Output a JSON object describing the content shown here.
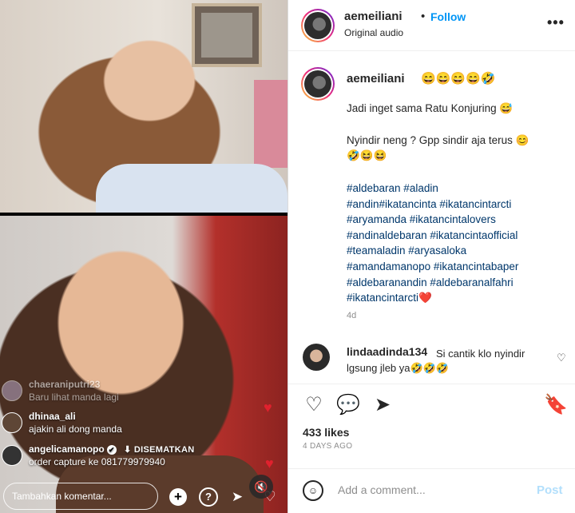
{
  "live": {
    "comments": [
      {
        "user": "chaeraniputri23",
        "text": "Baru lihat manda lagi"
      },
      {
        "user": "dhinaa_ali",
        "text": "ajakin ali dong manda"
      },
      {
        "user": "angelicamanopo",
        "pinned_label": "DISEMATKAN",
        "text": "order capture ke 081779979940"
      }
    ],
    "comment_placeholder": "Tambahkan komentar...",
    "icons": {
      "add": "+",
      "question": "?",
      "send": "➤",
      "heart": "♡",
      "mute": "🔇",
      "verified": "✔",
      "pin": "⬇",
      "float_heart": "♥"
    }
  },
  "post": {
    "author": "aemeiliani",
    "follow_label": "Follow",
    "audio": "Original audio",
    "more_icon": "•••",
    "author_emojis": "😄😄😄😄🤣",
    "caption_line1": "Jadi inget sama Ratu Konjuring 😅",
    "caption_line2": "Nyindir neng ? Gpp sindir aja terus 😊",
    "caption_line3": "🤣😆😆",
    "hashtags": [
      "#aldebaran #aladin",
      "#andin#ikatancinta #ikatancintarcti",
      "#aryamanda #ikatancintalovers",
      "#andinaldebaran #ikatancintaofficial",
      "#teamaladin #aryasaloka",
      "#amandamanopo #ikatancintabaper",
      "#aldebaranandin #aldebaranalfahri",
      "#ikatancintarcti❤️"
    ],
    "age": "4d",
    "comment": {
      "user": "lindaadinda134",
      "text": "Si cantik klo nyindir lgsung jleb ya🤣🤣🤣"
    },
    "likes": "433 likes",
    "date": "4 DAYS AGO",
    "add_comment_placeholder": "Add a comment...",
    "post_label": "Post",
    "action_icons": {
      "like": "♡",
      "comment": "💬",
      "share": "➤",
      "save": "🔖",
      "emoji": "☺"
    }
  }
}
